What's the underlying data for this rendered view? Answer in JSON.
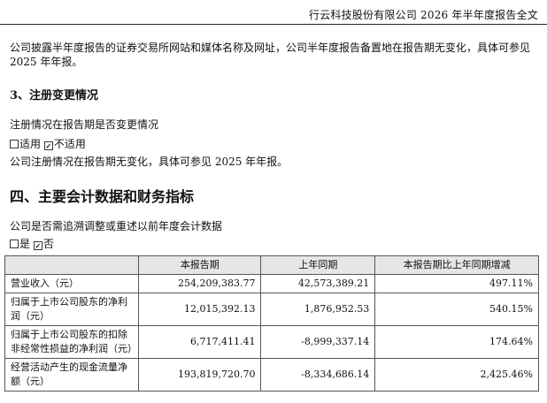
{
  "header": {
    "title": "行云科技股份有限公司 2026 年半年度报告全文"
  },
  "intro_text": "公司披露半年度报告的证券交易所网站和媒体名称及网址，公司半年度报告备置地在报告期无变化，具体可参见 2025 年年报。",
  "section3": {
    "heading": "3、注册变更情况",
    "question": "注册情况在报告期是否变更情况",
    "opt_applicable": "适用",
    "opt_not_applicable": "不适用",
    "conclusion": "公司注册情况在报告期无变化，具体可参见 2025 年年报。"
  },
  "section4": {
    "heading": "四、主要会计数据和财务指标",
    "question": "公司是否需追溯调整或重述以前年度会计数据",
    "opt_yes": "是",
    "opt_no": "否"
  },
  "table": {
    "headers": [
      "",
      "本报告期",
      "上年同期",
      "本报告期比上年同期增减"
    ],
    "rows": [
      {
        "label": "营业收入（元）",
        "current": "254,209,383.77",
        "prior": "42,573,389.21",
        "change": "497.11%"
      },
      {
        "label": "归属于上市公司股东的净利润（元）",
        "current": "12,015,392.13",
        "prior": "1,876,952.53",
        "change": "540.15%"
      },
      {
        "label": "归属于上市公司股东的扣除非经常性损益的净利润（元）",
        "current": "6,717,411.41",
        "prior": "-8,999,337.14",
        "change": "174.64%"
      },
      {
        "label": "经营活动产生的现金流量净额（元）",
        "current": "193,819,720.70",
        "prior": "-8,334,686.14",
        "change": "2,425.46%"
      }
    ]
  }
}
